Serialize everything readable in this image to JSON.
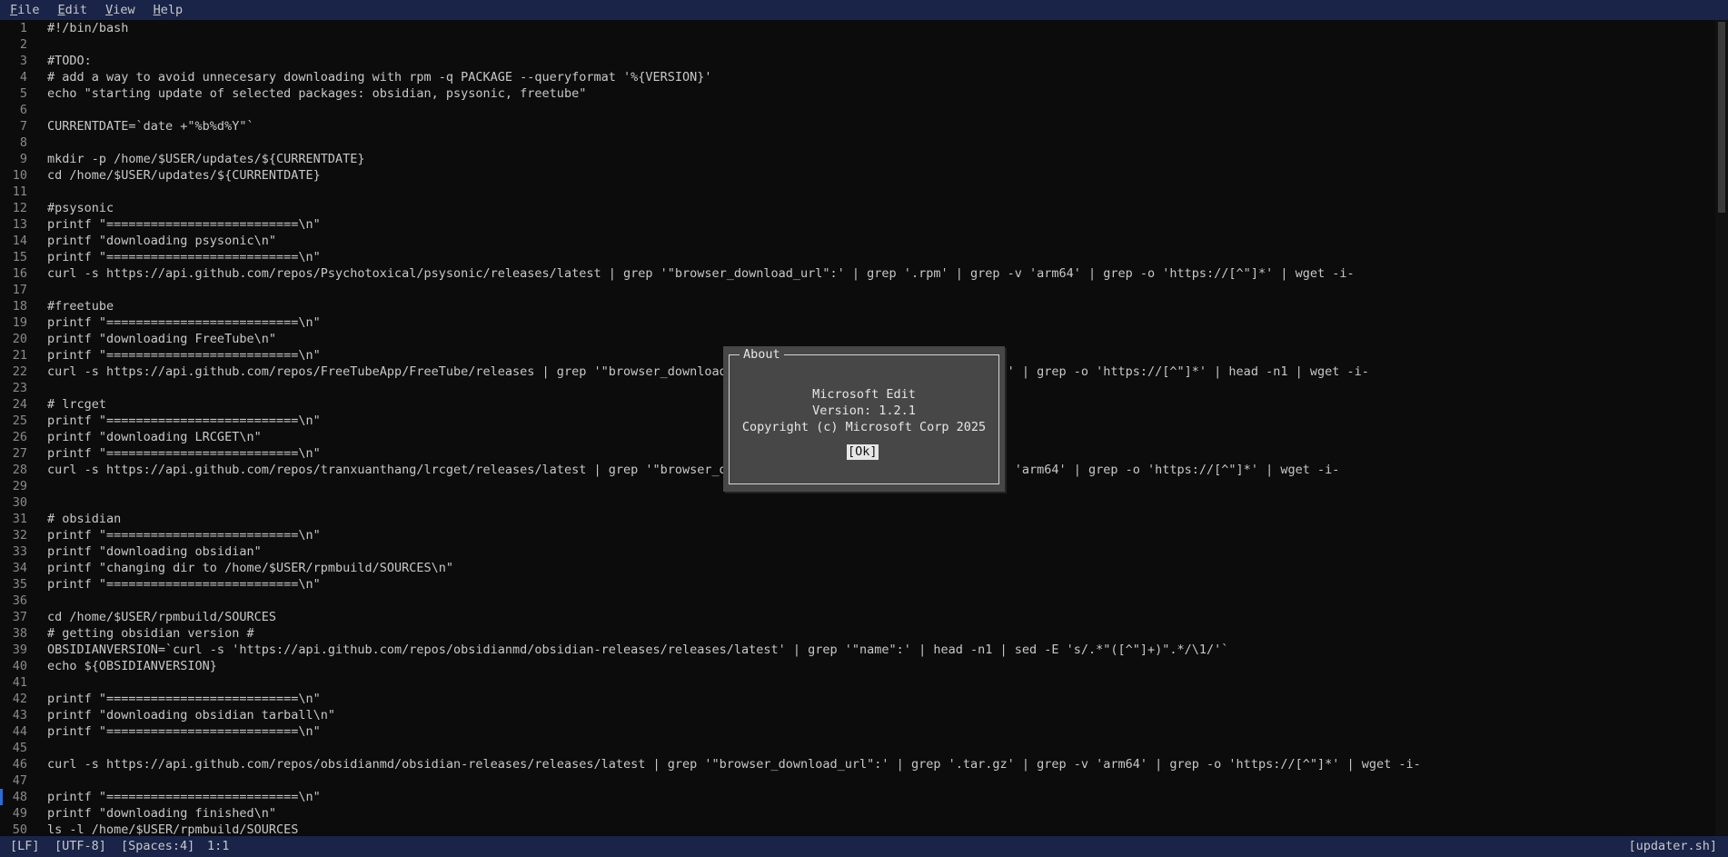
{
  "menubar": {
    "items": [
      {
        "key": "F",
        "rest": "ile"
      },
      {
        "key": "E",
        "rest": "dit"
      },
      {
        "key": "V",
        "rest": "iew"
      },
      {
        "key": "H",
        "rest": "elp"
      }
    ]
  },
  "editor": {
    "lines": [
      "#!/bin/bash",
      "",
      "#TODO:",
      "# add a way to avoid unnecesary downloading with rpm -q PACKAGE --queryformat '%{VERSION}'",
      "echo \"starting update of selected packages: obsidian, psysonic, freetube\"",
      "",
      "CURRENTDATE=`date +\"%b%d%Y\"`",
      "",
      "mkdir -p /home/$USER/updates/${CURRENTDATE}",
      "cd /home/$USER/updates/${CURRENTDATE}",
      "",
      "#psysonic",
      "printf \"==========================\\n\"",
      "printf \"downloading psysonic\\n\"",
      "printf \"==========================\\n\"",
      "curl -s https://api.github.com/repos/Psychotoxical/psysonic/releases/latest | grep '\"browser_download_url\":' | grep '.rpm' | grep -v 'arm64' | grep -o 'https://[^\"]*' | wget -i-",
      "",
      "#freetube",
      "printf \"==========================\\n\"",
      "printf \"downloading FreeTube\\n\"",
      "printf \"==========================\\n\"",
      "curl -s https://api.github.com/repos/FreeTubeApp/FreeTube/releases | grep '\"browser_download_url\":' | grep '.rpm' | grep -v 'arm64' | grep -o 'https://[^\"]*' | head -n1 | wget -i-",
      "",
      "# lrcget",
      "printf \"==========================\\n\"",
      "printf \"downloading LRCGET\\n\"",
      "printf \"==========================\\n\"",
      "curl -s https://api.github.com/repos/tranxuanthang/lrcget/releases/latest | grep '\"browser_download_url\":' | grep '.rpm' | grep -v 'arm64' | grep -o 'https://[^\"]*' | wget -i-",
      "",
      "",
      "# obsidian",
      "printf \"==========================\\n\"",
      "printf \"downloading obsidian\"",
      "printf \"changing dir to /home/$USER/rpmbuild/SOURCES\\n\"",
      "printf \"==========================\\n\"",
      "",
      "cd /home/$USER/rpmbuild/SOURCES",
      "# getting obsidian version #",
      "OBSIDIANVERSION=`curl -s 'https://api.github.com/repos/obsidianmd/obsidian-releases/releases/latest' | grep '\"name\":' | head -n1 | sed -E 's/.*\"([^\"]+)\".*/\\1/'`",
      "echo ${OBSIDIANVERSION}",
      "",
      "printf \"==========================\\n\"",
      "printf \"downloading obsidian tarball\\n\"",
      "printf \"==========================\\n\"",
      "",
      "curl -s https://api.github.com/repos/obsidianmd/obsidian-releases/releases/latest | grep '\"browser_download_url\":' | grep '.tar.gz' | grep -v 'arm64' | grep -o 'https://[^\"]*' | wget -i-",
      "",
      "printf \"==========================\\n\"",
      "printf \"downloading finished\\n\"",
      "ls -l /home/$USER/rpmbuild/SOURCES"
    ]
  },
  "statusbar": {
    "line_ending": "[LF]",
    "encoding": "[UTF-8]",
    "indent": "[Spaces:4]",
    "position": "1:1",
    "filename": "[updater.sh]"
  },
  "about_dialog": {
    "title": "About",
    "app_name": "Microsoft Edit",
    "version": "Version: 1.2.1",
    "copyright": "Copyright (c) Microsoft Corp 2025",
    "ok_label": "[Ok]"
  },
  "colors": {
    "menubar_bg": "#192448",
    "editor_bg": "#0c0c0c",
    "dialog_bg": "#474747",
    "cursor_line_marker": "#2b6cd8"
  }
}
